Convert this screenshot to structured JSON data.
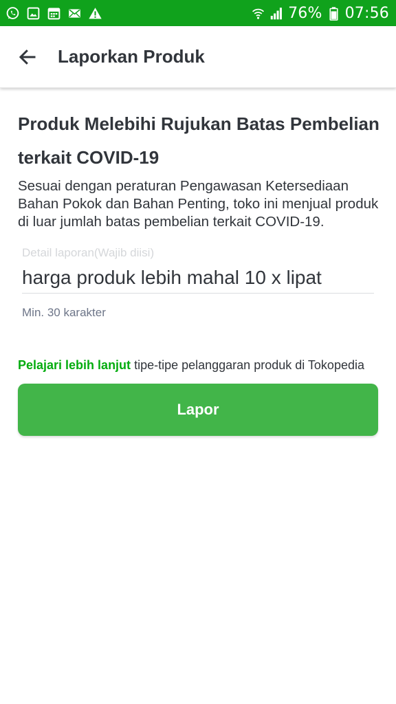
{
  "status_bar": {
    "background": "#10a21c",
    "left_icons": [
      "whatsapp-icon",
      "gallery-icon",
      "calendar-icon",
      "mail-icon",
      "warning-icon"
    ],
    "right_icons": [
      "wifi-icon",
      "signal-icon",
      "battery-icon"
    ],
    "battery_percent": "76%",
    "time": "07:56"
  },
  "header": {
    "back_icon": "arrow-left-icon",
    "title": "Laporkan Produk"
  },
  "report": {
    "title": "Produk Melebihi Rujukan Batas Pembelian terkait COVID-19",
    "description": "Sesuai dengan peraturan Pengawasan Ketersediaan Bahan Pokok dan Bahan Penting, toko ini menjual produk di luar jumlah batas pembelian terkait COVID-19."
  },
  "detail_field": {
    "label": "Detail laporan(Wajib diisi)",
    "value": "harga produk lebih mahal 10 x lipat",
    "helper": "Min. 30 karakter"
  },
  "learn_more": {
    "link_text": "Pelajari lebih lanjut",
    "rest_text": " tipe-tipe pelanggaran produk di Tokopedia"
  },
  "submit": {
    "label": "Lapor"
  },
  "colors": {
    "accent_green": "#42b549",
    "link_green": "#03ac0e",
    "text_primary": "#31353b",
    "text_hint": "#d5d7da",
    "text_secondary": "#6d7588"
  }
}
